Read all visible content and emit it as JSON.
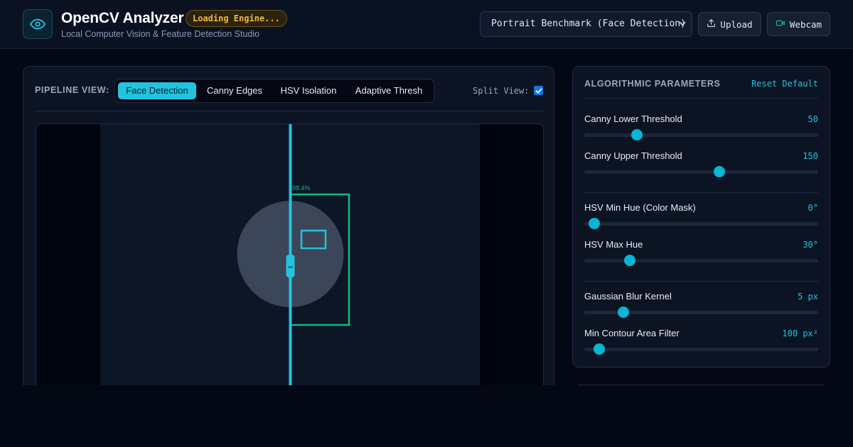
{
  "header": {
    "title": "OpenCV Analyzer",
    "status": "Loading Engine...",
    "subtitle": "Local Computer Vision & Feature Detection Studio",
    "preset": "Portrait Benchmark (Face Detection)",
    "upload_label": "Upload",
    "webcam_label": "Webcam"
  },
  "pipeline": {
    "label": "PIPELINE VIEW:",
    "tabs": [
      {
        "label": "Face Detection",
        "active": true
      },
      {
        "label": "Canny Edges",
        "active": false
      },
      {
        "label": "HSV Isolation",
        "active": false
      },
      {
        "label": "Adaptive Thresh",
        "active": false
      }
    ],
    "split_label": "Split View:",
    "split_checked": true
  },
  "detection": {
    "confidence_label": "98.4%",
    "split_handle": "↔"
  },
  "params": {
    "title": "ALGORITHMIC PARAMETERS",
    "reset_label": "Reset Default",
    "items": [
      {
        "label": "Canny Lower Threshold",
        "value": "50",
        "fraction": 0.21
      },
      {
        "label": "Canny Upper Threshold",
        "value": "150",
        "fraction": 0.58
      },
      {
        "label": "HSV Min Hue (Color Mask)",
        "value": "0°",
        "fraction": 0.02
      },
      {
        "label": "HSV Max Hue",
        "value": "30°",
        "fraction": 0.18
      },
      {
        "label": "Gaussian Blur Kernel",
        "value": "5 px",
        "fraction": 0.15
      },
      {
        "label": "Min Contour Area Filter",
        "value": "100 px²",
        "fraction": 0.04
      }
    ]
  },
  "colors": {
    "accent": "#22c3de",
    "detection_box": "#10b981",
    "warning": "#f4b740"
  },
  "icons": {
    "logo": "eye-icon",
    "upload": "upload-icon",
    "webcam": "video-camera-icon"
  }
}
